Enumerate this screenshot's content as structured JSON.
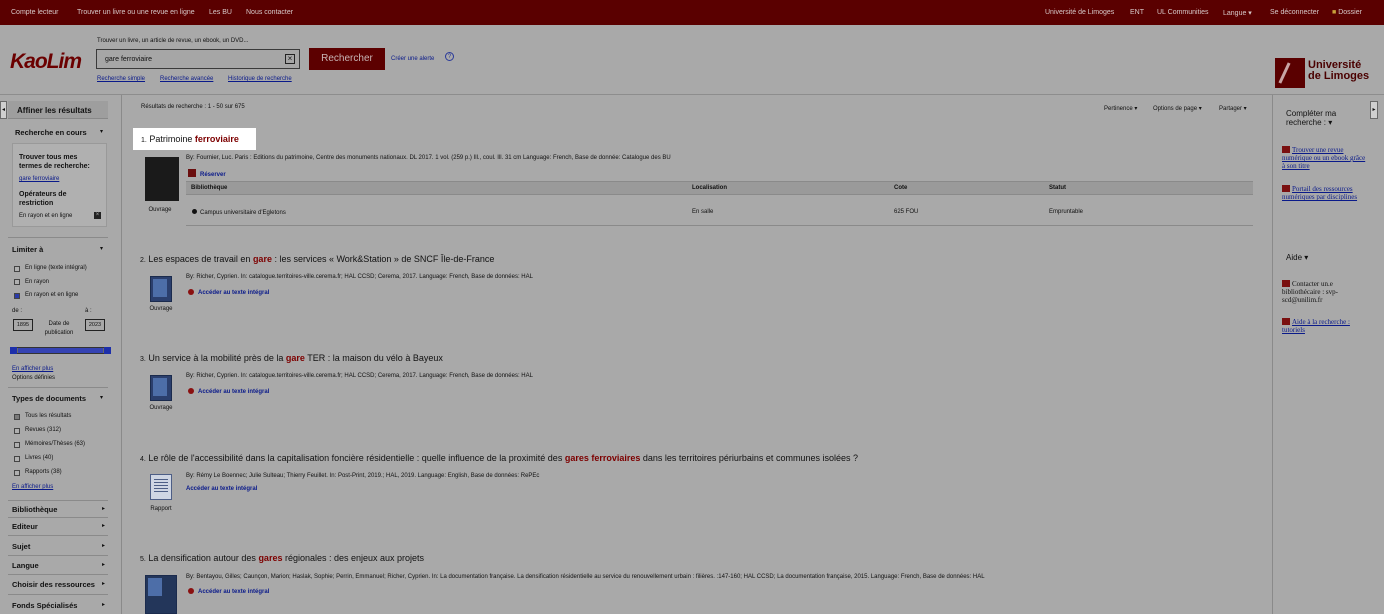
{
  "topbar": {
    "left": [
      "Compte lecteur",
      "Trouver un livre ou une revue en ligne",
      "Les BU",
      "Nous contacter"
    ],
    "right": [
      "Université de Limoges",
      "ENT",
      "UL Communities",
      "Langue",
      "Se déconnecter",
      "Dossier"
    ]
  },
  "header": {
    "logo": "KaoLim",
    "hint": "Trouver un livre, un article de revue, un ebook, un DVD...",
    "search_value": "gare ferroviaire",
    "search_button": "Rechercher",
    "alert_link": "Créer une alerte",
    "links": [
      "Recherche simple",
      "Recherche avancée",
      "Historique de recherche"
    ],
    "university": [
      "Université",
      "de Limoges"
    ]
  },
  "left": {
    "title": "Affiner les résultats",
    "current_search": "Recherche en cours",
    "find_all": "Trouver tous mes termes de recherche:",
    "terms": "gare ferroviaire",
    "restriction": "Opérateurs de restriction",
    "restriction_value": "En rayon et en ligne",
    "limit": "Limiter à",
    "limits": [
      "En ligne (texte intégral)",
      "En rayon",
      "En rayon et en ligne"
    ],
    "from": "de :",
    "to": "à :",
    "year_from": "1895",
    "year_to": "2023",
    "pub_date": "Date de publication",
    "show_more": "En afficher plus",
    "options": "Options définies",
    "doc_types": "Types de documents",
    "types": [
      "Tous les résultats",
      "Revues (312)",
      "Mémoires/Thèses (63)",
      "Livres (40)",
      "Rapports (38)"
    ],
    "show_more2": "En afficher plus",
    "facets": [
      "Bibliothèque",
      "Editeur",
      "Sujet",
      "Langue",
      "Choisir des ressources",
      "Fonds Spécialisés"
    ]
  },
  "main": {
    "count": "Résultats de recherche : 1 - 50 sur 675",
    "tools": [
      "Pertinence",
      "Options de page",
      "Partager"
    ],
    "results": [
      {
        "num": "1.",
        "title_pre": "Patrimoine ",
        "title_hl": "ferroviaire",
        "title_post": "",
        "meta": "By: Fournier, Luc. Paris : Editions du patrimoine, Centre des monuments nationaux. DL 2017. 1 vol. (259 p.) Ill., coul. Ill. 31 cm Language: French, Base de donnée: Catalogue des BU",
        "link": "Réserver",
        "type": "Ouvrage"
      },
      {
        "num": "2.",
        "title_pre": "Les espaces de travail en ",
        "title_hl": "gare",
        "title_post": " : les services « Work&Station » de SNCF Île-de-France",
        "meta": "By: Richer, Cyprien. In: catalogue.territoires-ville.cerema.fr; HAL CCSD; Cerema, 2017. Language: French, Base de données: HAL",
        "link": "Accéder au texte intégral",
        "type": "Ouvrage"
      },
      {
        "num": "3.",
        "title_pre": "Un service à la mobilité près de la ",
        "title_hl": "gare",
        "title_post": " TER : la maison du vélo à Bayeux",
        "meta": "By: Richer, Cyprien. In: catalogue.territoires-ville.cerema.fr; HAL CCSD; Cerema, 2017. Language: French, Base de données: HAL",
        "link": "Accéder au texte intégral",
        "type": "Ouvrage"
      },
      {
        "num": "4.",
        "title_pre": "Le rôle de l'accessibilité dans la capitalisation foncière résidentielle : quelle influence de la proximité des ",
        "title_hl": "gares ferroviaires",
        "title_post": " dans les territoires périurbains et communes isolées ?",
        "meta": "By: Rémy Le Boennec; Julie Sulteau; Thierry Feuillet. In: Post-Print, 2019.; HAL, 2019. Language: English, Base de données: RePEc",
        "link": "Accéder au texte intégral",
        "type": "Rapport"
      },
      {
        "num": "5.",
        "title_pre": "La densification autour des ",
        "title_hl": "gares",
        "title_post": " régionales : des enjeux aux projets",
        "meta": "By: Bentayou, Gilles; Caunçon, Marion; Haslak, Sophie; Perrin, Emmanuel; Richer, Cyprien. In: La documentation française. La densification résidentielle au service du renouvellement urbain : filières. :147-160; HAL CCSD; La documentation française, 2015. Language: French, Base de données: HAL",
        "link": "Accéder au texte intégral",
        "type": ""
      }
    ],
    "holdings": {
      "headers": [
        "Bibliothèque",
        "Localisation",
        "Cote",
        "Statut"
      ],
      "row": [
        "Campus universitaire d'Egletons",
        "En salle",
        "625 FOU",
        "Empruntable"
      ]
    }
  },
  "right": {
    "complete": "Compléter ma recherche :",
    "link1": "Trouver une revue numérique ou un ebook grâce à son titre",
    "link2": "Portail des ressources numériques par disciplines",
    "aide": "Aide",
    "contact": "Contacter un.e bibliothécaire : svp-scd@unilim.fr",
    "link3": "Aide à la recherche : tutoriels"
  },
  "colors": {
    "brand": "#5a0000",
    "highlight": "#7d0000",
    "link": "#0a1a8a"
  }
}
